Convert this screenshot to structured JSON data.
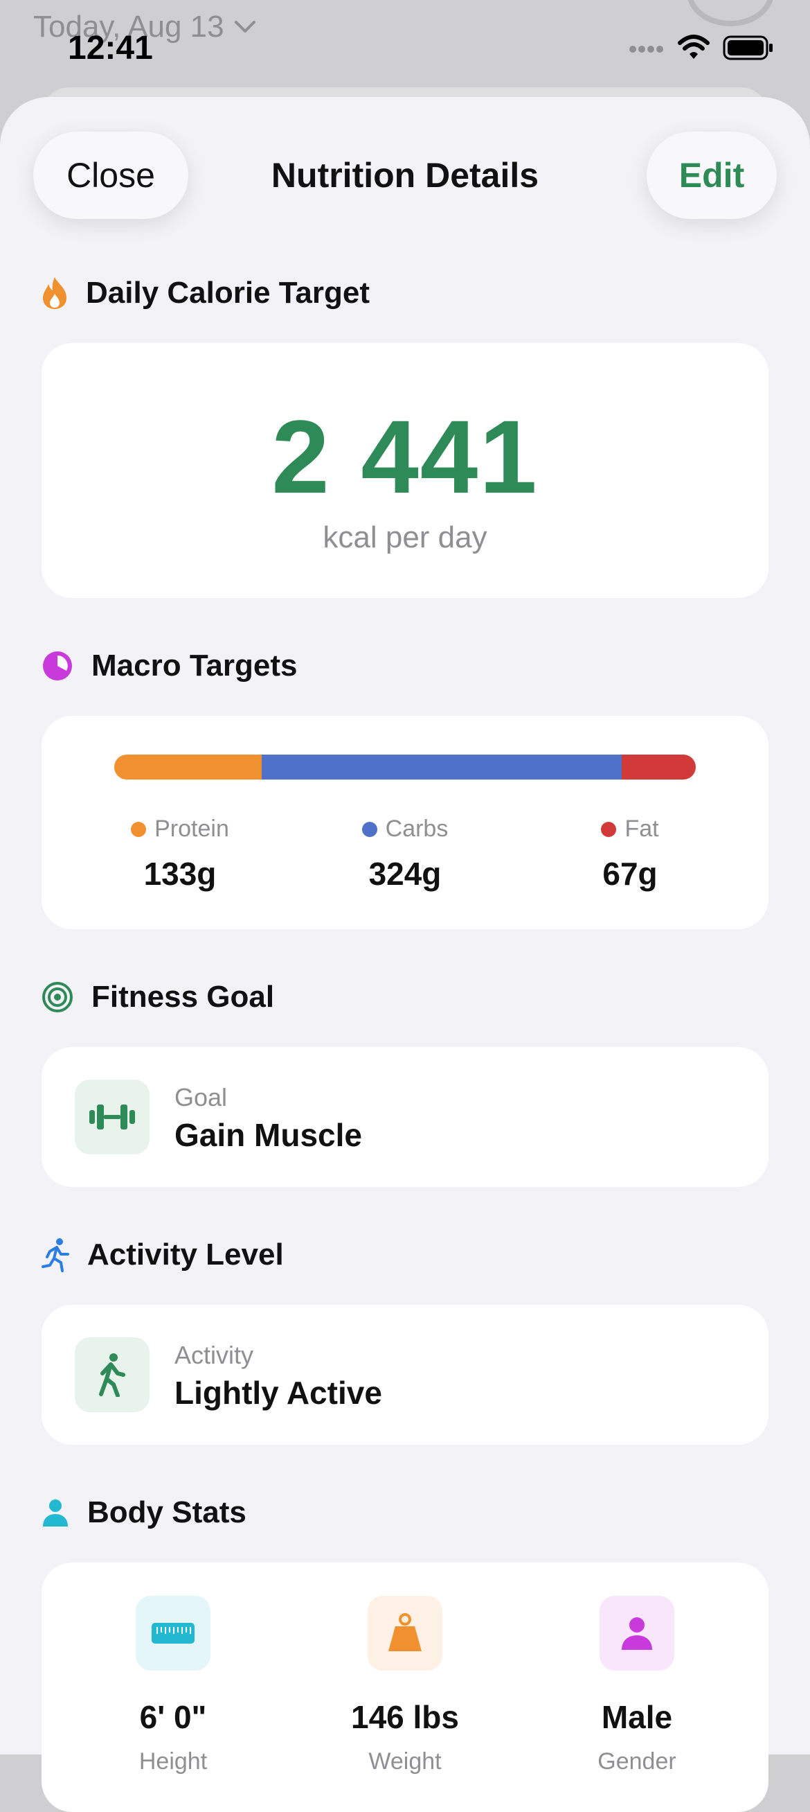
{
  "background": {
    "date_label": "Today, Aug 13"
  },
  "status_bar": {
    "time": "12:41"
  },
  "nav": {
    "close_label": "Close",
    "title": "Nutrition Details",
    "edit_label": "Edit"
  },
  "calorie": {
    "section_title": "Daily Calorie Target",
    "icon": "flame-icon",
    "value": "2 441",
    "unit": "kcal per day"
  },
  "macros": {
    "section_title": "Macro Targets",
    "icon": "pie-chart-icon",
    "items": [
      {
        "label": "Protein",
        "value": "133g",
        "grams": 133,
        "color": "#f0902f"
      },
      {
        "label": "Carbs",
        "value": "324g",
        "grams": 324,
        "color": "#4f72c8"
      },
      {
        "label": "Fat",
        "value": "67g",
        "grams": 67,
        "color": "#d23a3a"
      }
    ]
  },
  "fitness_goal": {
    "section_title": "Fitness Goal",
    "icon": "target-icon",
    "label": "Goal",
    "value": "Gain Muscle"
  },
  "activity": {
    "section_title": "Activity Level",
    "icon": "running-icon",
    "label": "Activity",
    "value": "Lightly Active"
  },
  "body_stats": {
    "section_title": "Body Stats",
    "icon": "person-icon",
    "items": [
      {
        "value": "6' 0\"",
        "label": "Height",
        "icon": "ruler-icon",
        "color": "#22b8cf"
      },
      {
        "value": "146 lbs",
        "label": "Weight",
        "icon": "weight-icon",
        "color": "#f0902f"
      },
      {
        "value": "Male",
        "label": "Gender",
        "icon": "person-icon",
        "color": "#c83adb"
      }
    ]
  },
  "colors": {
    "accent_green": "#2e8b57",
    "background": "#f2f2f7"
  }
}
